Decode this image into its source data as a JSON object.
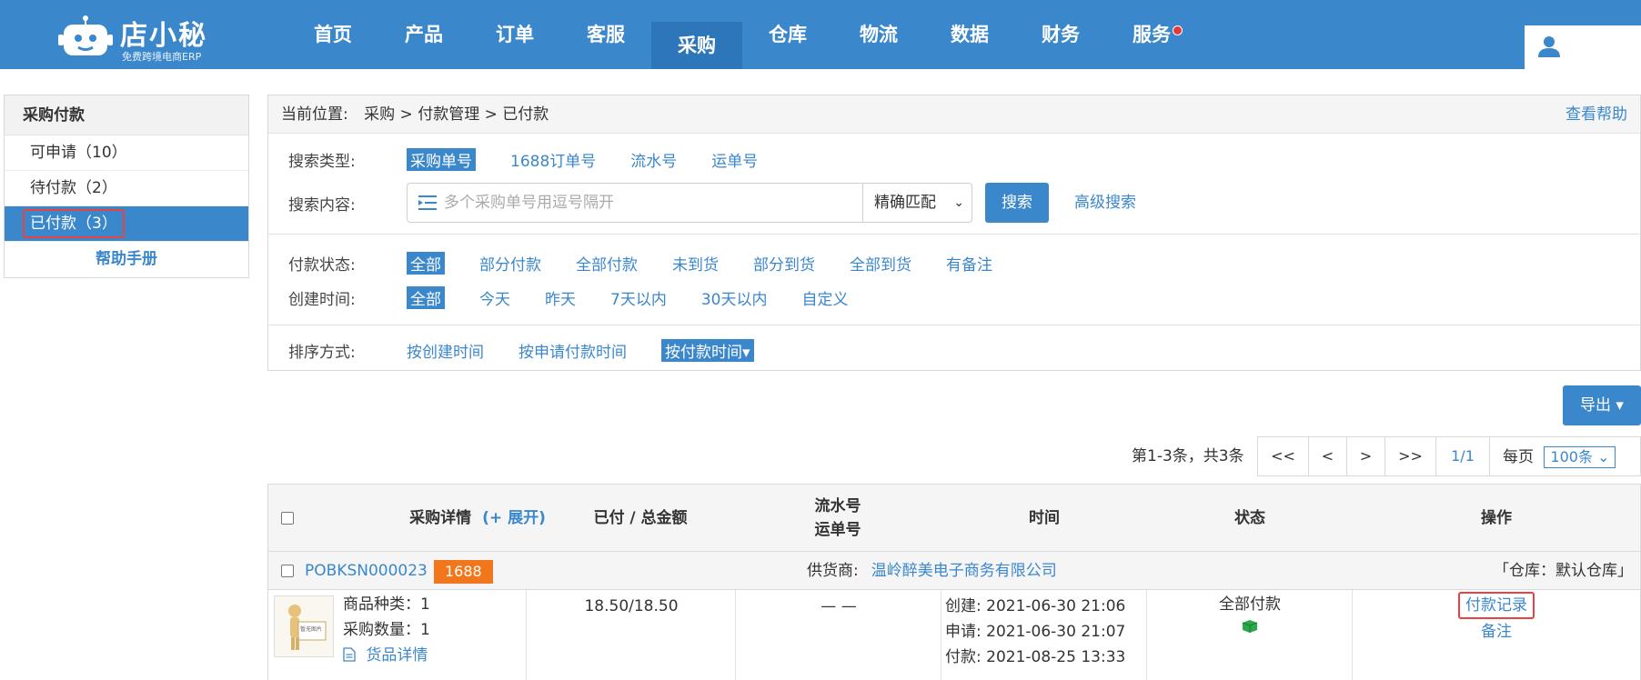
{
  "app": {
    "logo_title": "店小秘",
    "logo_sub": "免费跨境电商ERP"
  },
  "nav": {
    "items": [
      {
        "label": "首页"
      },
      {
        "label": "产品"
      },
      {
        "label": "订单"
      },
      {
        "label": "客服"
      },
      {
        "label": "采购"
      },
      {
        "label": "仓库"
      },
      {
        "label": "物流"
      },
      {
        "label": "数据"
      },
      {
        "label": "财务"
      },
      {
        "label": "服务"
      }
    ],
    "active_index": 4
  },
  "sidebar": {
    "title": "采购付款",
    "items": [
      {
        "label": "可申请（10）"
      },
      {
        "label": "待付款（2）"
      },
      {
        "label": "已付款（3）"
      }
    ],
    "help": "帮助手册"
  },
  "breadcrumb": {
    "label": "当前位置:",
    "path": "采购 > 付款管理 > 已付款",
    "help": "查看帮助"
  },
  "filters": {
    "search_type_label": "搜索类型:",
    "search_types": [
      "采购单号",
      "1688订单号",
      "流水号",
      "运单号"
    ],
    "search_content_label": "搜索内容:",
    "search_placeholder": "多个采购单号用逗号隔开",
    "match_mode": "精确匹配",
    "search_button": "搜索",
    "advanced_search": "高级搜索",
    "pay_status_label": "付款状态:",
    "pay_statuses": [
      "全部",
      "部分付款",
      "全部付款",
      "未到货",
      "部分到货",
      "全部到货",
      "有备注"
    ],
    "created_label": "创建时间:",
    "created_options": [
      "全部",
      "今天",
      "昨天",
      "7天以内",
      "30天以内",
      "自定义"
    ],
    "sort_label": "排序方式:",
    "sort_options": [
      "按创建时间",
      "按申请付款时间",
      "按付款时间▾"
    ]
  },
  "toolbar": {
    "export": "导出 ▾",
    "page_info": "第1-3条，共3条",
    "pager": [
      "<<",
      "<",
      ">",
      ">>",
      "1/1"
    ],
    "per_page_label": "每页",
    "per_page_value": "100条 ⌄"
  },
  "table": {
    "headers": {
      "detail": "采购详情",
      "expand": "(+ 展开)",
      "amount": "已付 / 总金额",
      "serial": "流水号",
      "tracking": "运单号",
      "time": "时间",
      "status": "状态",
      "action": "操作"
    },
    "order": {
      "po_number": "POBKSN000023",
      "badge": "1688",
      "supplier_label": "供货商:",
      "supplier": "温岭醉美电子商务有限公司",
      "warehouse": "「仓库：默认仓库」",
      "sku_types": "商品种类：1",
      "quantity": "采购数量：1",
      "goods_detail": "货品详情",
      "amount": "18.50/18.50",
      "serial": "— —",
      "created": "创建:   2021-06-30 21:06",
      "applied": "申请:   2021-06-30 21:07",
      "paid": "付款:   2021-08-25 13:33",
      "status": "全部付款",
      "action_record": "付款记录",
      "action_note": "备注",
      "thumb_text": "暂无图片"
    }
  },
  "colors": {
    "primary": "#3b87cc",
    "badge": "#f2761c",
    "highlight": "#e84343"
  }
}
